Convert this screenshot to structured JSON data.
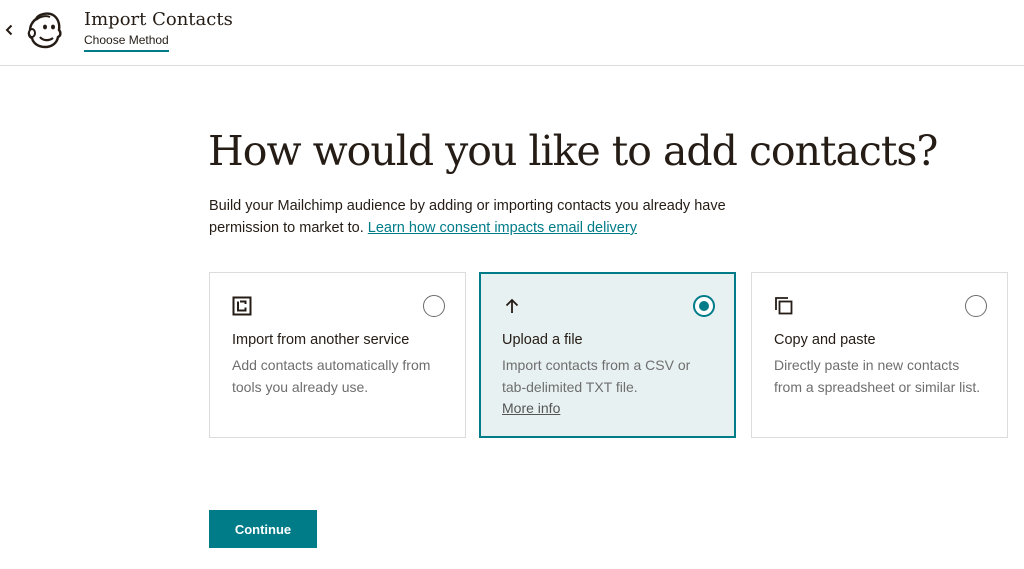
{
  "header": {
    "back_icon": "chevron-left-icon",
    "logo_icon": "mailchimp-freddie-logo",
    "title": "Import Contacts",
    "tab": "Choose Method"
  },
  "main": {
    "heading": "How would you like to add contacts?",
    "intro_text": "Build your Mailchimp audience by adding or importing contacts you already have permission to market to.",
    "intro_link": "Learn how consent impacts email delivery"
  },
  "options": [
    {
      "icon": "import-service-icon",
      "title": "Import from another service",
      "description": "Add contacts automatically from tools you already use.",
      "selected": false
    },
    {
      "icon": "arrow-up-icon",
      "title": "Upload a file",
      "description": "Import contacts from a CSV or tab-delimited TXT file.",
      "link": "More info",
      "selected": true
    },
    {
      "icon": "copy-icon",
      "title": "Copy and paste",
      "description": "Directly paste in new contacts from a spreadsheet or similar list.",
      "selected": false
    }
  ],
  "actions": {
    "continue_label": "Continue"
  },
  "colors": {
    "accent": "#007c89",
    "selected_bg": "#e8f1f2",
    "text": "#241c15",
    "muted": "#6e6e6e"
  }
}
